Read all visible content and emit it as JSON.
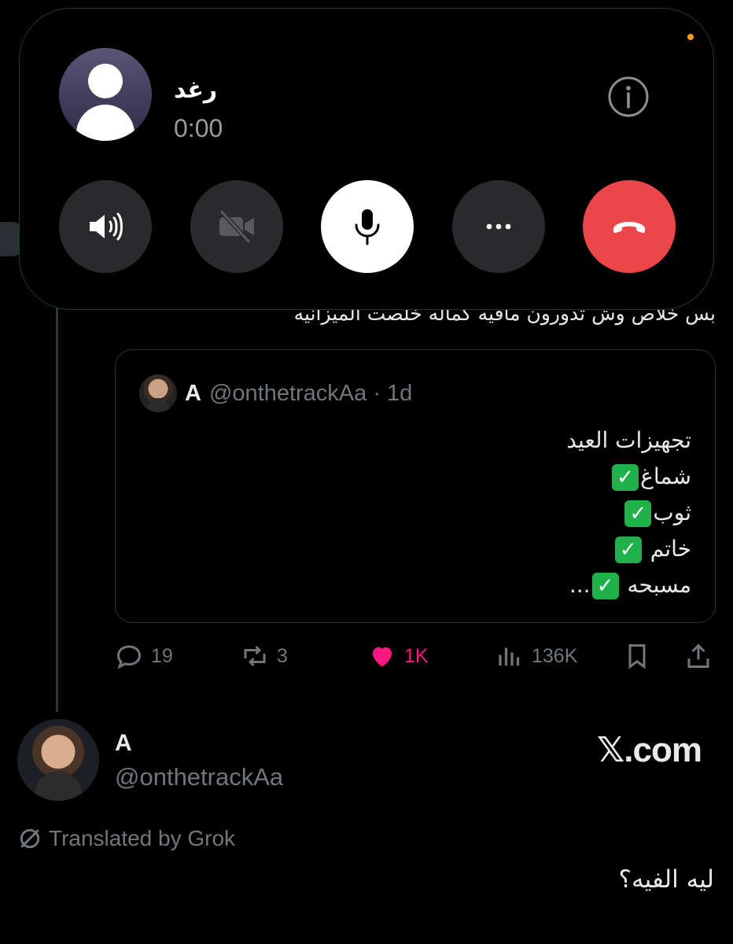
{
  "call": {
    "caller_name": "رغد",
    "duration": "0:00",
    "icons": {
      "info": "info-icon",
      "speaker": "speaker-icon",
      "video": "video-off-icon",
      "mic": "microphone-icon",
      "more": "more-icon",
      "end": "end-call-icon"
    },
    "colors": {
      "end_button": "#eb4649",
      "mic_button": "#ffffff",
      "status_dot": "#ff9f0a"
    }
  },
  "tweet": {
    "text": "بس خلاص وش تدورون مافيه كماله خلصت الميزانيه",
    "quote": {
      "name": "A",
      "handle_time": "@onthetrackAa · 1d",
      "lines": [
        "تجهيزات العيد",
        "شماغ",
        "ثوب",
        "خاتم",
        "مسبحه"
      ],
      "check_mark": "✓",
      "ellipsis": "..."
    },
    "actions": {
      "replies": "19",
      "retweets": "3",
      "likes": "1K",
      "views": "136K",
      "like_color": "#f91880"
    }
  },
  "reply": {
    "name": "A",
    "handle": "@onthetrackAa",
    "watermark": "𝕏.com",
    "translated_by": "Translated by Grok",
    "text": "ليه الفيه؟"
  }
}
